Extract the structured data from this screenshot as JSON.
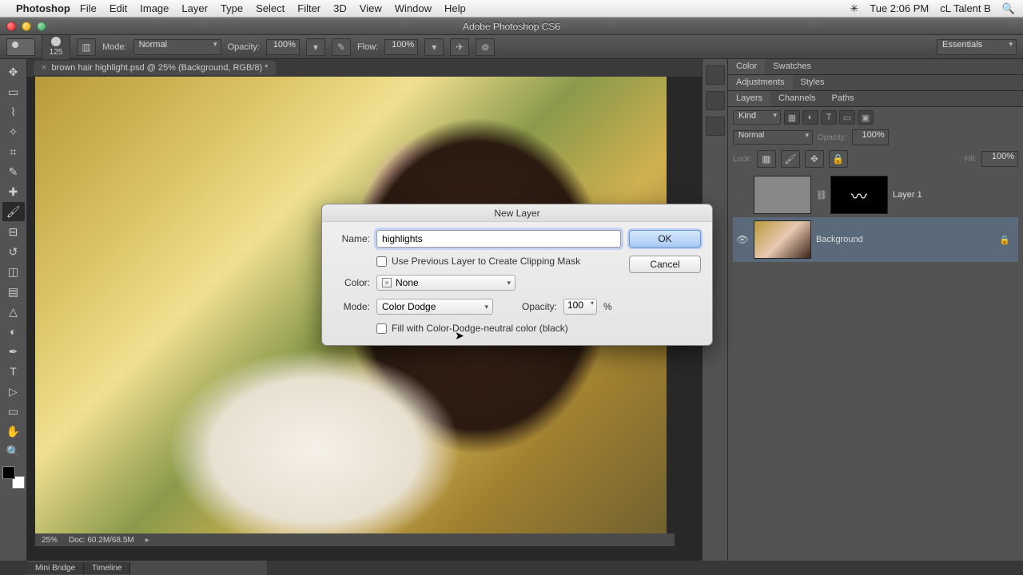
{
  "menubar": {
    "app": "Photoshop",
    "items": [
      "File",
      "Edit",
      "Image",
      "Layer",
      "Type",
      "Select",
      "Filter",
      "3D",
      "View",
      "Window",
      "Help"
    ],
    "right": {
      "time": "Tue 2:06 PM",
      "user": "cL Talent B"
    }
  },
  "window": {
    "title": "Adobe Photoshop CS6"
  },
  "options": {
    "brush_size": "125",
    "mode_label": "Mode:",
    "mode_value": "Normal",
    "opacity_label": "Opacity:",
    "opacity_value": "100%",
    "flow_label": "Flow:",
    "flow_value": "100%",
    "workspace": "Essentials"
  },
  "document": {
    "tab": "brown hair highlight.psd @ 25% (Background, RGB/8) *",
    "zoom": "25%",
    "docinfo": "Doc: 60.2M/68.5M"
  },
  "panels": {
    "color_tab": "Color",
    "swatches_tab": "Swatches",
    "adjustments_tab": "Adjustments",
    "styles_tab": "Styles",
    "layers_tab": "Layers",
    "channels_tab": "Channels",
    "paths_tab": "Paths",
    "kind_label": "Kind",
    "blend_mode": "Normal",
    "opacity_label": "Opacity:",
    "opacity_value": "100%",
    "lock_label": "Lock:",
    "fill_label": "Fill:",
    "fill_value": "100%",
    "layers": [
      {
        "name": "Layer 1",
        "visible": false,
        "mask": true
      },
      {
        "name": "Background",
        "visible": true,
        "locked": true
      }
    ]
  },
  "bottom": {
    "mini_bridge": "Mini Bridge",
    "timeline": "Timeline"
  },
  "dialog": {
    "title": "New Layer",
    "name_label": "Name:",
    "name_value": "highlights",
    "use_previous": "Use Previous Layer to Create Clipping Mask",
    "color_label": "Color:",
    "color_value": "None",
    "mode_label": "Mode:",
    "mode_value": "Color Dodge",
    "opacity_label": "Opacity:",
    "opacity_value": "100",
    "opacity_unit": "%",
    "fill_neutral": "Fill with Color-Dodge-neutral color (black)",
    "ok": "OK",
    "cancel": "Cancel"
  }
}
